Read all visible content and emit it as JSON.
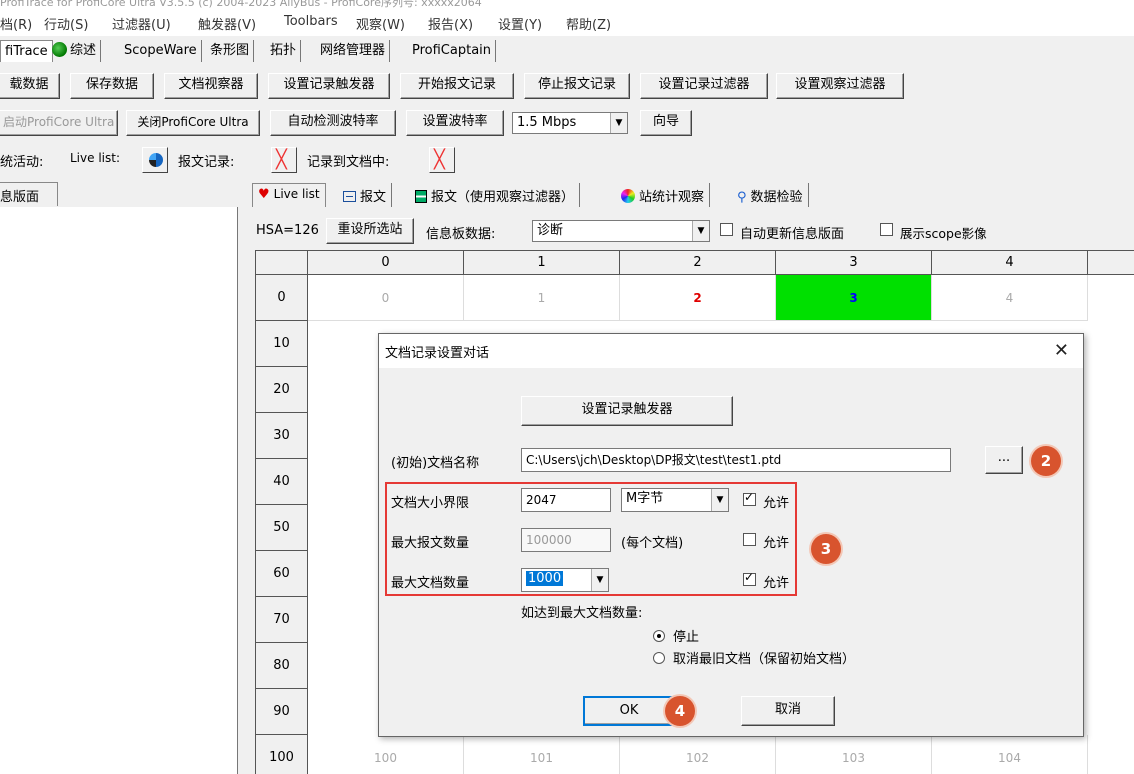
{
  "window": {
    "title": "ProfiTrace for ProfiCore Ultra V3.5.5 (c) 2004-2023 AllyBus - ProfiCore序列号: xxxxx2064"
  },
  "menu": [
    "档(R)",
    "行动(S)",
    "过滤器(U)",
    "触发器(V)",
    "Toolbars",
    "观察(W)",
    "报告(X)",
    "设置(Y)",
    "帮助(Z)"
  ],
  "main_tabs": [
    "fiTrace",
    "综述",
    "ScopeWare",
    "条形图",
    "拓扑",
    "网络管理器",
    "ProfiCaptain"
  ],
  "toolbar1": [
    "载数据",
    "保存数据",
    "文档视察器",
    "设置记录触发器",
    "开始报文记录",
    "停止报文记录",
    "设置记录过滤器",
    "设置观察过滤器"
  ],
  "toolbar2": {
    "start_label": "启动ProfiCore Ultra",
    "close_label": "关闭ProfiCore Ultra",
    "auto_baud": "自动检测波特率",
    "set_baud": "设置波特率",
    "baud_value": "1.5 Mbps",
    "wizard": "向导"
  },
  "status": {
    "prefix": "统活动:",
    "live_list": "Live list:",
    "record": "报文记录:",
    "record_doc": "记录到文档中:"
  },
  "left_panel": {
    "tab": "息版面"
  },
  "sub_tabs": [
    "Live list",
    "报文",
    "报文（使用观察过滤器）",
    "站统计观察",
    "数据检验"
  ],
  "info_row": {
    "hsa": "HSA=126",
    "reset_btn": "重设所选站",
    "board_label": "信息板数据:",
    "board_value": "诊断",
    "auto_update": "自动更新信息版面",
    "show_scope": "展示scope影像"
  },
  "grid": {
    "col_headers": [
      "0",
      "1",
      "2",
      "3",
      "4"
    ],
    "row_headers": [
      "0",
      "10",
      "20",
      "30",
      "40",
      "50",
      "60",
      "70",
      "80",
      "90",
      "100"
    ],
    "row0": [
      "0",
      "1",
      "2",
      "3",
      "4"
    ],
    "row100": [
      "100",
      "101",
      "102",
      "103",
      "104"
    ],
    "active_station_color": "#00e000",
    "row0_colors": [
      "#aaaaaa",
      "#aaaaaa",
      "#e00000",
      "#0000ff",
      "#aaaaaa"
    ]
  },
  "dialog": {
    "title": "文档记录设置对话",
    "trigger_btn": "设置记录触发器",
    "doc_name_label": "(初始)文档名称",
    "doc_name_value": "C:\\Users\\jch\\Desktop\\DP报文\\test\\test1.ptd",
    "browse_label": "...",
    "size_label": "文档大小界限",
    "size_value": "2047",
    "size_unit": "M字节",
    "size_allow": "允许",
    "max_msg_label": "最大报文数量",
    "max_msg_value": "100000",
    "max_msg_note": "(每个文档)",
    "max_msg_allow": "允许",
    "max_doc_label": "最大文档数量",
    "max_doc_value": "1000",
    "max_doc_allow": "允许",
    "reach_label": "如达到最大文档数量:",
    "opt_stop": "停止",
    "opt_cancel_old": "取消最旧文档（保留初始文档）",
    "ok": "OK",
    "cancel": "取消"
  },
  "badges": [
    "2",
    "3",
    "4"
  ]
}
